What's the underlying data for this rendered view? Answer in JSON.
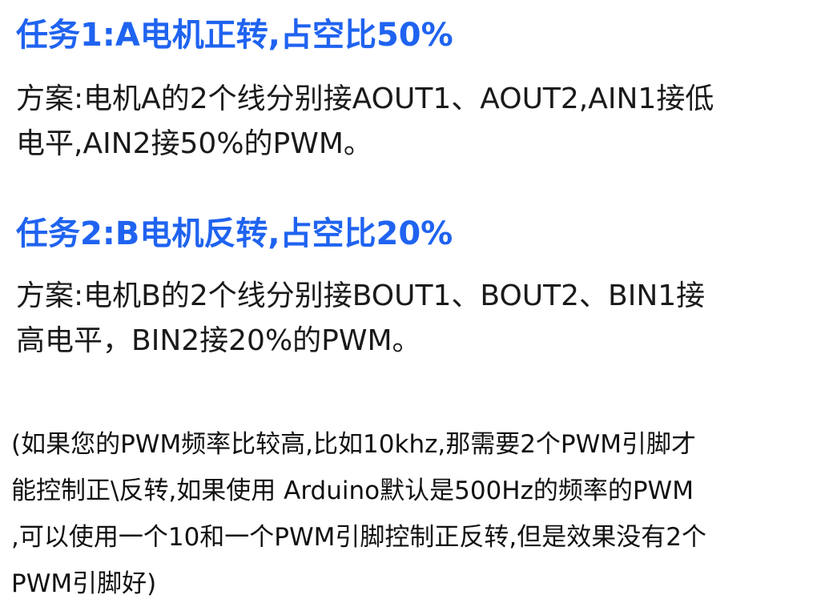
{
  "task1": {
    "title": "任务1:A电机正转,占空比50%",
    "plan_lines": [
      "方案:电机A的2个线分别接AOUT1、AOUT2,AIN1接低",
      "电平,AIN2接50%的PWM。"
    ]
  },
  "task2": {
    "title": "任务2:B电机反转,占空比20%",
    "plan_lines": [
      "方案:电机B的2个线分别接BOUT1、BOUT2、BIN1接",
      "高电平，BIN2接20%的PWM。"
    ]
  },
  "note": {
    "lines": [
      "(如果您的PWM频率比较高,比如10khz,那需要2个PWM引脚才",
      "能控制正\\反转,如果使用 Arduino默认是500Hz的频率的PWM",
      ",可以使用一个10和一个PWM引脚控制正反转,但是效果没有2个",
      "PWM引脚好)"
    ]
  },
  "colors": {
    "heading": "#1f63f0",
    "text": "#1a1a1a"
  }
}
